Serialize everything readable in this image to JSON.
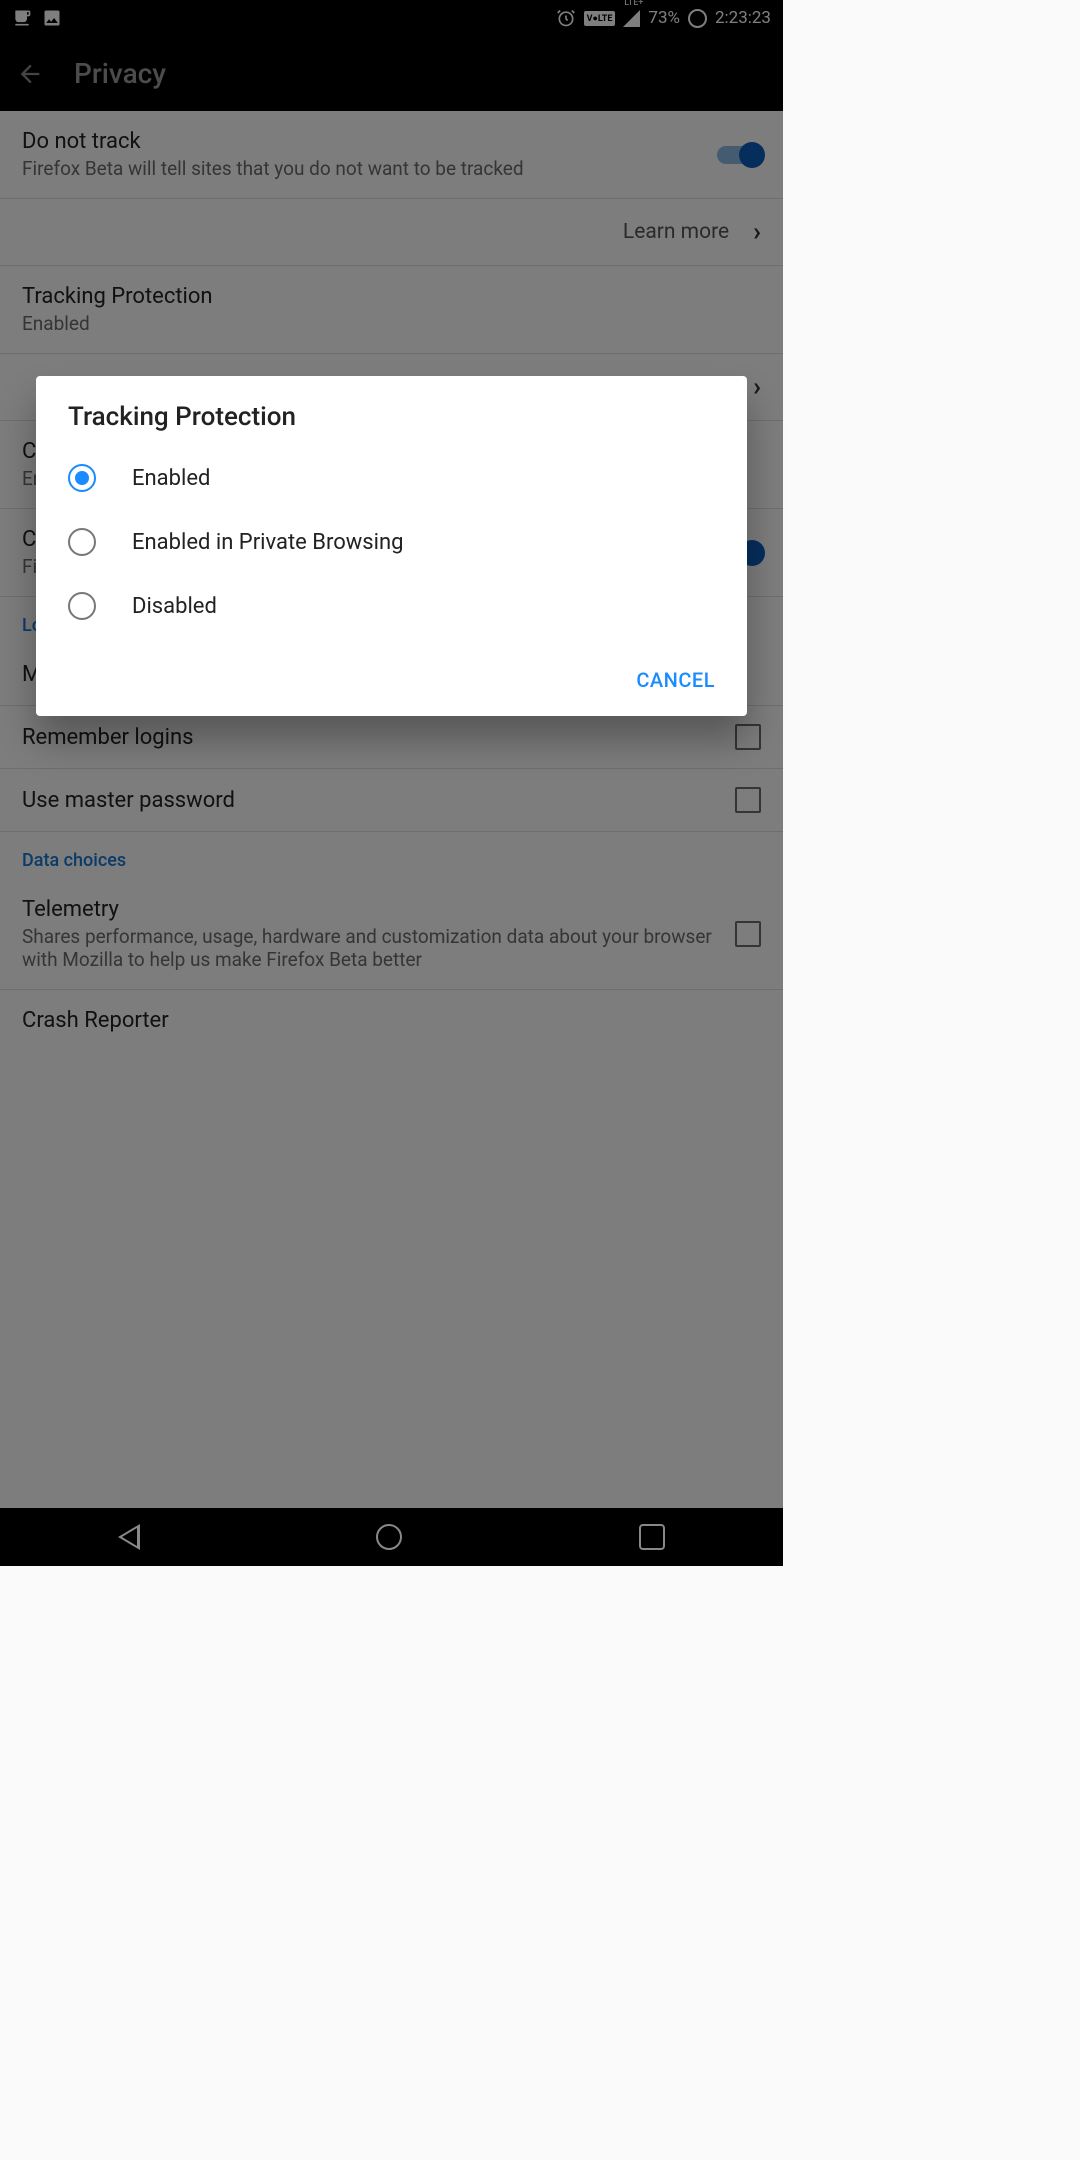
{
  "status": {
    "volte": "V●LTE",
    "lte": "LTE+",
    "battery": "73%",
    "time": "2:23:23"
  },
  "appbar": {
    "title": "Privacy"
  },
  "settings": {
    "dnt_title": "Do not track",
    "dnt_sub": "Firefox Beta will tell sites that you do not want to be tracked",
    "learn_more": "Learn more",
    "tp_title": "Tracking Protection",
    "tp_sub": "Enabled",
    "cookies_title": "Cookies",
    "cookies_sub": "Enabled",
    "clear_title": "Clear private data",
    "clear_sub": "Firefox Beta will clear selected data on exit",
    "logins_header": "Logins",
    "manage_logins": "Manage logins",
    "remember_logins": "Remember logins",
    "master_pw": "Use master password",
    "data_header": "Data choices",
    "telemetry_title": "Telemetry",
    "telemetry_sub": "Shares performance, usage, hardware and customization data about your browser with Mozilla to help us make Firefox Beta better",
    "crash_title": "Crash Reporter"
  },
  "dialog": {
    "title": "Tracking Protection",
    "opt_enabled": "Enabled",
    "opt_private": "Enabled in Private Browsing",
    "opt_disabled": "Disabled",
    "cancel": "CANCEL"
  }
}
